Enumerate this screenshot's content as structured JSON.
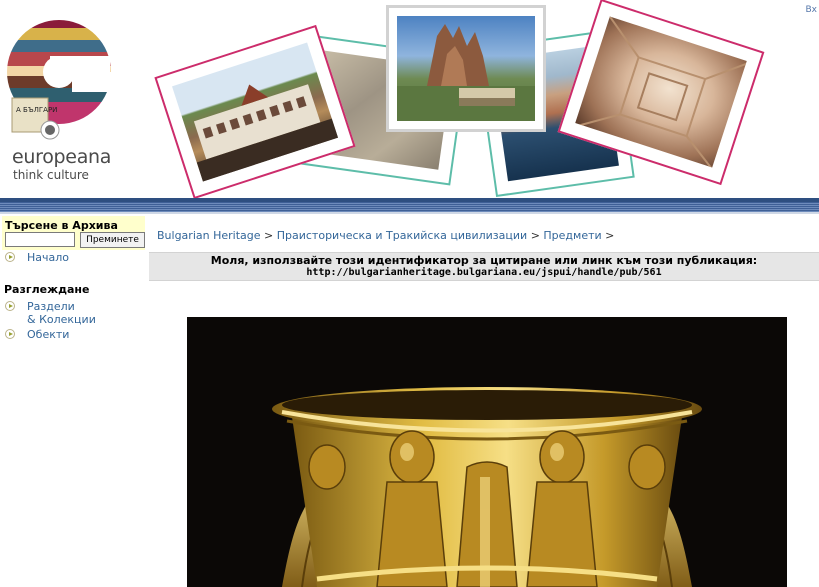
{
  "header": {
    "logo_word": "europeana",
    "logo_tagline": "think culture",
    "logo_badge_text": "А БЪЛГАРИ",
    "login_link": "Вх",
    "photos": [
      {
        "name": "rila-monastery-photo",
        "frame_color": "#cc2c6b"
      },
      {
        "name": "rock-photo",
        "frame_color": "#5dbda9"
      },
      {
        "name": "belogradchik-fortress-photo",
        "frame_color": "#cfcfcf"
      },
      {
        "name": "seaside-town-photo",
        "frame_color": "#5dbda9"
      },
      {
        "name": "thracian-tomb-photo",
        "frame_color": "#cc2c6b"
      }
    ],
    "stripe_color": "#3f6096"
  },
  "sidebar": {
    "search_title": "Търсене в Архива",
    "search_placeholder": "",
    "search_button": "Преминете",
    "home_link": "Начало",
    "browse_title": "Разглеждане",
    "browse_items": [
      "Раздели\n& Колекции",
      "Обекти"
    ]
  },
  "breadcrumb": {
    "items": [
      "Bulgarian Heritage",
      "Праисторическа и Тракийска цивилизации",
      "Предмети"
    ],
    "separator": ">"
  },
  "citation": {
    "message": "Моля, използвайте този идентификатор за цитиране или линк към този публикация:",
    "url": "http://bulgarianheritage.bulgariana.eu/jspui/handle/pub/561"
  },
  "colors": {
    "link": "#336699",
    "search_background": "#ffffcc",
    "citation_background": "#e6e6e6",
    "gold": "#c9a227"
  }
}
